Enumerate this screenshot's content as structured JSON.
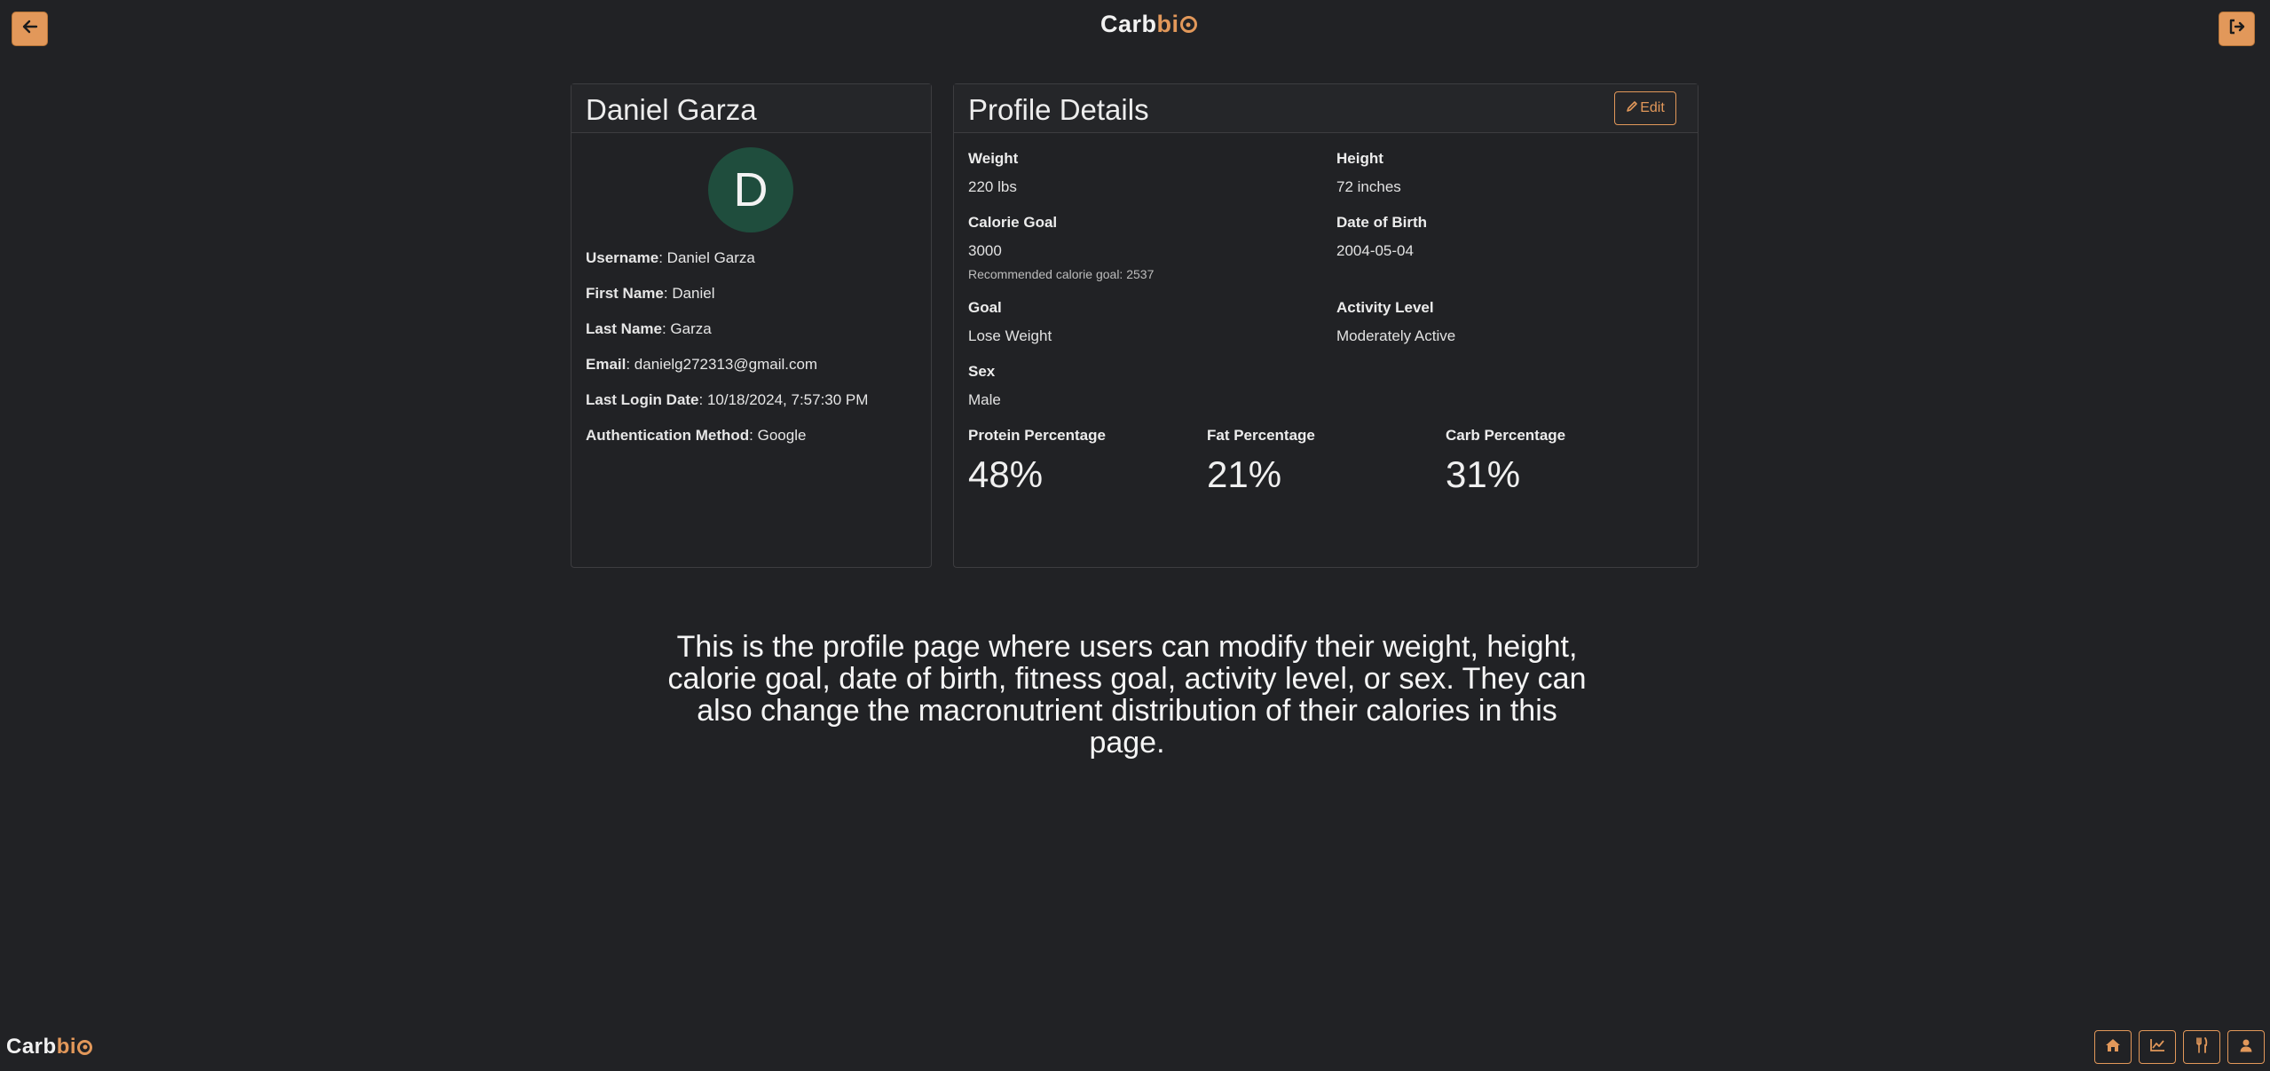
{
  "header": {
    "logo_main": "Carb",
    "logo_accent_i": "i",
    "back_icon": "arrow-left-icon",
    "logout_icon": "sign-out-icon"
  },
  "profile_card": {
    "name": "Daniel Garza",
    "avatar_letter": "D",
    "fields": [
      {
        "label": "Username",
        "value": ": Daniel Garza"
      },
      {
        "label": "First Name",
        "value": ": Daniel"
      },
      {
        "label": "Last Name",
        "value": ": Garza"
      },
      {
        "label": "Email",
        "value": ": danielg272313@gmail.com"
      },
      {
        "label": "Last Login Date",
        "value": ": 10/18/2024, 7:57:30 PM"
      },
      {
        "label": "Authentication Method",
        "value": ": Google"
      }
    ]
  },
  "details_card": {
    "title": "Profile Details",
    "edit_label": "Edit",
    "weight_label": "Weight",
    "weight_value": "220 lbs",
    "height_label": "Height",
    "height_value": "72 inches",
    "calorie_label": "Calorie Goal",
    "calorie_value": "3000",
    "calorie_hint": "Recommended calorie goal: 2537",
    "dob_label": "Date of Birth",
    "dob_value": "2004-05-04",
    "goal_label": "Goal",
    "goal_value": "Lose Weight",
    "activity_label": "Activity Level",
    "activity_value": "Moderately Active",
    "sex_label": "Sex",
    "sex_value": "Male",
    "protein_label": "Protein Percentage",
    "protein_value": "48%",
    "fat_label": "Fat Percentage",
    "fat_value": "21%",
    "carb_label": "Carb Percentage",
    "carb_value": "31%"
  },
  "description": "This is the profile page where users can modify their weight, height, calorie goal, date of birth, fitness goal, activity level, or sex. They can also change the macronutrient distribution of their calories in this page.",
  "footer": {
    "logo_main": "Carb",
    "logo_accent_i": "i",
    "nav": [
      "home-icon",
      "chart-line-icon",
      "utensils-icon",
      "user-icon"
    ]
  },
  "colors": {
    "background": "#212225",
    "accent": "#e2985a",
    "avatar": "#1f4d3d"
  }
}
